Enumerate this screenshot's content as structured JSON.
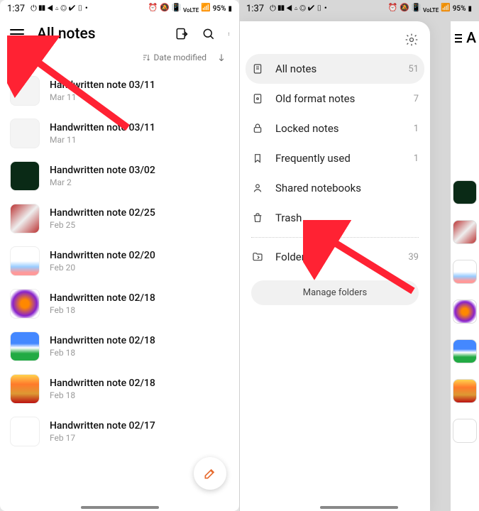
{
  "statusbar": {
    "time": "1:37",
    "left_icons": [
      "⏻",
      "❚❚",
      "◀",
      "▵",
      "◎",
      "✔",
      "▯"
    ],
    "right_text": "95%",
    "right_icons": [
      "⏰",
      "🔇",
      "📶",
      "VoLTE",
      "📶"
    ]
  },
  "main": {
    "title": "All notes",
    "sort_label": "Date modified",
    "notes": [
      {
        "title": "Handwritten note 03/11",
        "date": "Mar 11",
        "thumb_bg": "#f4f4f4"
      },
      {
        "title": "Handwritten note 03/11",
        "date": "Mar 11",
        "thumb_bg": "#f4f4f4"
      },
      {
        "title": "Handwritten note 03/02",
        "date": "Mar 2",
        "thumb_bg": "#0a2a16"
      },
      {
        "title": "Handwritten note 02/25",
        "date": "Feb 25",
        "thumb_bg": "linear-gradient(135deg,#b33,#eee,#b33)"
      },
      {
        "title": "Handwritten note 02/20",
        "date": "Feb 20",
        "thumb_bg": "linear-gradient(180deg,#fff 50%,#9cf 70%,#f99 90%)"
      },
      {
        "title": "Handwritten note 02/18",
        "date": "Feb 18",
        "thumb_bg": "radial-gradient(#f80 20%,#82c 60%,#fff 80%)"
      },
      {
        "title": "Handwritten note 02/18",
        "date": "Feb 18",
        "thumb_bg": "linear-gradient(180deg,#48f 40%,#fff 55%,#2a4 75%)"
      },
      {
        "title": "Handwritten note 02/18",
        "date": "Feb 18",
        "thumb_bg": "linear-gradient(180deg,#ffd24d,#ff7a2b,#d93,#b11)"
      },
      {
        "title": "Handwritten note 02/17",
        "date": "Feb 17",
        "thumb_bg": "#fff"
      }
    ]
  },
  "drawer": {
    "items": [
      {
        "icon": "note",
        "label": "All notes",
        "count": "51",
        "active": true
      },
      {
        "icon": "oldnote",
        "label": "Old format notes",
        "count": "7"
      },
      {
        "icon": "lock",
        "label": "Locked notes",
        "count": "1"
      },
      {
        "icon": "bookmark",
        "label": "Frequently used",
        "count": "1"
      },
      {
        "icon": "person",
        "label": "Shared notebooks",
        "count": ""
      },
      {
        "icon": "trash",
        "label": "Trash",
        "count": ""
      }
    ],
    "folders": {
      "label": "Folders",
      "count": "39"
    },
    "manage": "Manage folders"
  },
  "peek_title": "A"
}
